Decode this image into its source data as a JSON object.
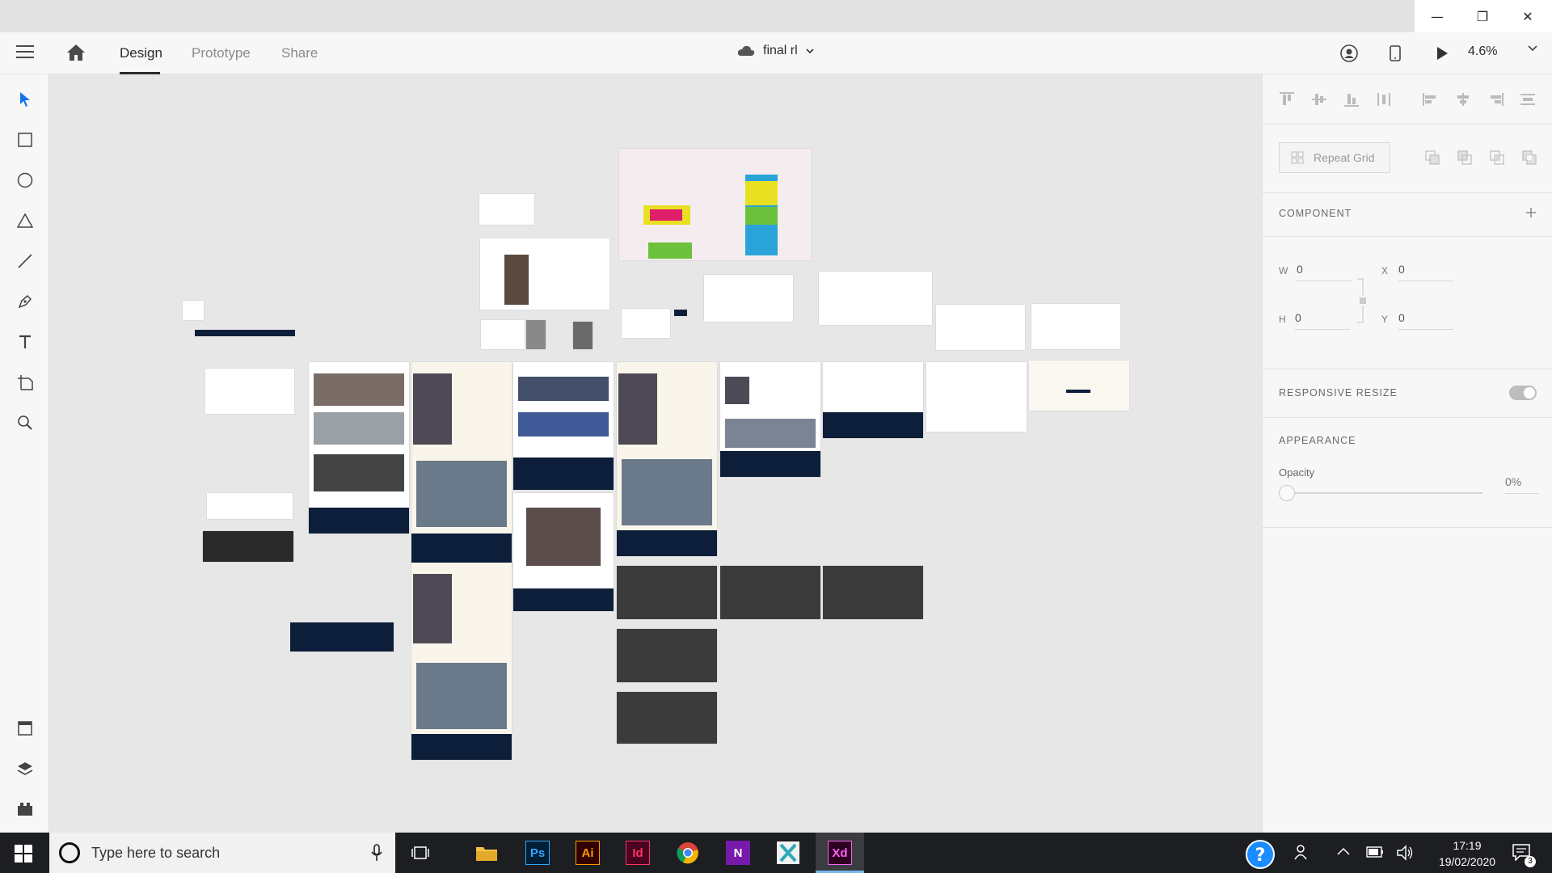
{
  "window": {
    "controls": {
      "minimize": "—",
      "restore": "❐",
      "close": "✕"
    }
  },
  "header": {
    "tabs": [
      {
        "label": "Design",
        "active": true
      },
      {
        "label": "Prototype",
        "active": false
      },
      {
        "label": "Share",
        "active": false
      }
    ],
    "document_title": "final rl",
    "zoom": "4.6%"
  },
  "toolbar": {
    "tools": [
      "select-tool",
      "rectangle-tool",
      "ellipse-tool",
      "polygon-tool",
      "line-tool",
      "pen-tool",
      "text-tool",
      "artboard-tool",
      "zoom-tool"
    ],
    "bottom_tools": [
      "assets",
      "layers",
      "plugins"
    ]
  },
  "panel": {
    "repeat_grid_label": "Repeat Grid",
    "component_title": "COMPONENT",
    "w_label": "W",
    "w_value": "0",
    "h_label": "H",
    "h_value": "0",
    "x_label": "X",
    "x_value": "0",
    "y_label": "Y",
    "y_value": "0",
    "responsive_resize_title": "RESPONSIVE RESIZE",
    "responsive_resize_on": false,
    "appearance_title": "APPEARANCE",
    "opacity_label": "Opacity",
    "opacity_value": "0%"
  },
  "taskbar": {
    "search_placeholder": "Type here to search",
    "apps": [
      "File Explorer",
      "Photoshop",
      "Illustrator",
      "InDesign",
      "Chrome",
      "OneNote",
      "XMind",
      "Adobe XD"
    ],
    "ps_label": "Ps",
    "ai_label": "Ai",
    "id_label": "Id",
    "xd_label": "Xd",
    "n_label": "N",
    "time": "17:19",
    "date": "19/02/2020",
    "notifications": "3"
  },
  "colors": {
    "navy": "#0d1e3a",
    "accent_blue": "#1473e6",
    "xd_pink": "#ff2bc2"
  }
}
